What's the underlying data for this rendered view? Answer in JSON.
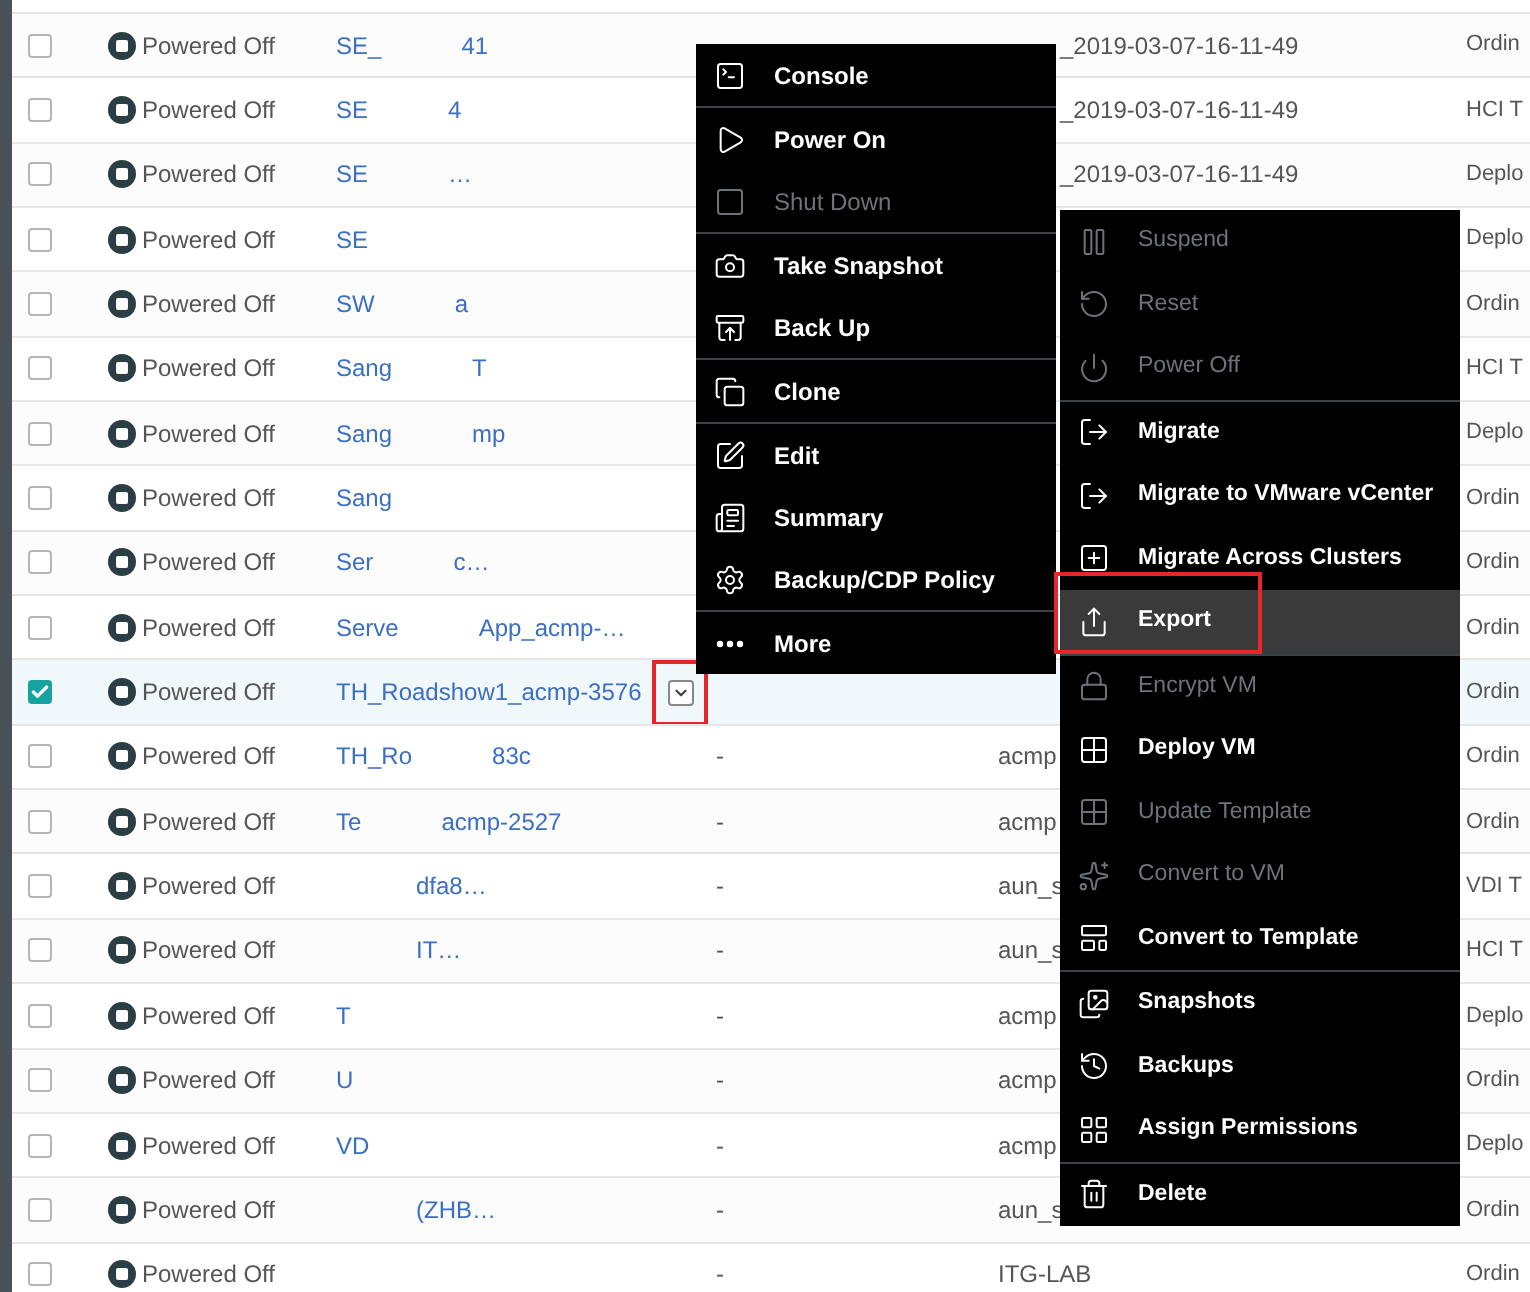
{
  "rows": [
    {
      "checked": false,
      "status": "Powered Off",
      "name_start": "SE_",
      "name_end": "41",
      "column_4": "_2019-03-07-16-11-49",
      "column_5": "Ordin"
    },
    {
      "checked": false,
      "status": "Powered Off",
      "name_start": "SE",
      "name_end": "4",
      "column_4": "_2019-03-07-16-11-49",
      "column_5": "HCI T"
    },
    {
      "checked": false,
      "status": "Powered Off",
      "name_start": "SE",
      "name_end": "…",
      "column_4": "_2019-03-07-16-11-49",
      "column_5": "Deplo"
    },
    {
      "checked": false,
      "status": "Powered Off",
      "name_start": "SE",
      "column_5": "Deplo"
    },
    {
      "checked": false,
      "status": "Powered Off",
      "name_start": "SW",
      "name_end": "a",
      "column_5": "Ordin"
    },
    {
      "checked": false,
      "status": "Powered Off",
      "name_start": "Sang",
      "name_end": "T",
      "column_5": "HCI T"
    },
    {
      "checked": false,
      "status": "Powered Off",
      "name_start": "Sang",
      "name_end": "mp",
      "column_5": "Deplo"
    },
    {
      "checked": false,
      "status": "Powered Off",
      "name_start": "Sang",
      "column_5": "Ordin"
    },
    {
      "checked": false,
      "status": "Powered Off",
      "name_start": "Ser",
      "name_end": "c…",
      "column_5": "Ordin"
    },
    {
      "checked": false,
      "status": "Powered Off",
      "name_start": "Serve",
      "name_end": "App_acmp-…",
      "column_5": "Ordin"
    },
    {
      "checked": true,
      "status": "Powered Off",
      "name_start": "TH_Roadshow1_acmp-3576",
      "column_5": "Ordin",
      "dropdown": true
    },
    {
      "checked": false,
      "status": "Powered Off",
      "name_start": "TH_Ro",
      "name_end": "83c",
      "column_3": "-",
      "column_4": "acmp",
      "column_5": "Ordin"
    },
    {
      "checked": false,
      "status": "Powered Off",
      "name_start": "Te",
      "name_end": "acmp-2527",
      "column_3": "-",
      "column_4": "acmp",
      "column_5": "Ordin"
    },
    {
      "checked": false,
      "status": "Powered Off",
      "name_end": "dfa8…",
      "column_3": "-",
      "column_4": "aun_s",
      "column_5": "VDI T"
    },
    {
      "checked": false,
      "status": "Powered Off",
      "name_end": "IT…",
      "column_3": "-",
      "column_4": "aun_s",
      "column_5": "HCI T"
    },
    {
      "checked": false,
      "status": "Powered Off",
      "name_start": "T",
      "column_3": "-",
      "column_4": "acmp",
      "column_5": "Deplo"
    },
    {
      "checked": false,
      "status": "Powered Off",
      "name_start": "U",
      "column_3": "-",
      "column_4": "acmp",
      "column_5": "Ordin"
    },
    {
      "checked": false,
      "status": "Powered Off",
      "name_start": "VD",
      "column_3": "-",
      "column_4": "acmp",
      "column_5": "Deplo"
    },
    {
      "checked": false,
      "status": "Powered Off",
      "name_end": "(ZHB…",
      "column_3": "-",
      "column_4": "aun_s",
      "column_5": "Ordin"
    },
    {
      "checked": false,
      "status": "Powered Off",
      "column_3": "-",
      "column_4": "ITG-LAB",
      "column_5": "Ordin"
    }
  ],
  "menu": {
    "groups": [
      [
        {
          "label": "Console",
          "disabled": false
        }
      ],
      [
        {
          "label": "Power On",
          "disabled": false
        },
        {
          "label": "Shut Down",
          "disabled": true
        }
      ],
      [
        {
          "label": "Take Snapshot",
          "disabled": false
        },
        {
          "label": "Back Up",
          "disabled": false
        }
      ],
      [
        {
          "label": "Clone",
          "disabled": false
        }
      ],
      [
        {
          "label": "Edit",
          "disabled": false
        },
        {
          "label": "Summary",
          "disabled": false
        },
        {
          "label": "Backup/CDP Policy",
          "disabled": false
        }
      ],
      [
        {
          "label": "More",
          "disabled": false
        }
      ]
    ]
  },
  "submenu": {
    "groups": [
      [
        {
          "label": "Suspend",
          "disabled": true,
          "selected": false
        },
        {
          "label": "Reset",
          "disabled": true,
          "selected": false
        },
        {
          "label": "Power Off",
          "disabled": true,
          "selected": false
        }
      ],
      [
        {
          "label": "Migrate",
          "disabled": false,
          "selected": false
        },
        {
          "label": "Migrate to VMware vCenter",
          "disabled": false,
          "selected": false
        },
        {
          "label": "Migrate Across Clusters",
          "disabled": false,
          "selected": false
        },
        {
          "label": "Export",
          "disabled": false,
          "selected": true,
          "annotated": true
        }
      ],
      [
        {
          "label": "Encrypt VM",
          "disabled": true,
          "selected": false
        },
        {
          "label": "Deploy VM",
          "disabled": false,
          "selected": false
        },
        {
          "label": "Update Template",
          "disabled": true,
          "selected": false
        },
        {
          "label": "Convert to VM",
          "disabled": true,
          "selected": false
        },
        {
          "label": "Convert to Template",
          "disabled": false,
          "selected": false
        }
      ],
      [
        {
          "label": "Snapshots",
          "disabled": false,
          "selected": false
        },
        {
          "label": "Backups",
          "disabled": false,
          "selected": false
        },
        {
          "label": "Assign Permissions",
          "disabled": false,
          "selected": false
        }
      ],
      [
        {
          "label": "Delete",
          "disabled": false,
          "selected": false
        }
      ]
    ]
  }
}
